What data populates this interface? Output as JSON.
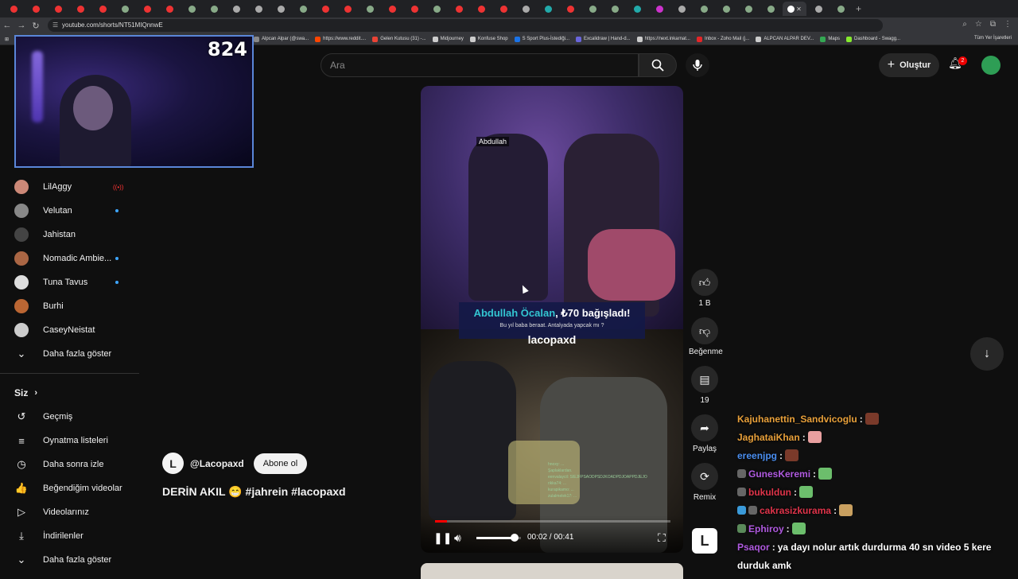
{
  "browser": {
    "url": "youtube.com/shorts/NT51MIQnnwE",
    "tab_colors": [
      "#e33",
      "#e33",
      "#e33",
      "#e33",
      "#e33",
      "#8a8",
      "#e33",
      "#e33",
      "#8a8",
      "#8a8",
      "#aaa",
      "#aaa",
      "#aaa",
      "#8a8",
      "#e33",
      "#e33",
      "#8a8",
      "#e33",
      "#e33",
      "#8a8",
      "#e33",
      "#e33",
      "#e33",
      "#aaa",
      "#2aa",
      "#e33",
      "#8a8",
      "#8a8",
      "#2aa",
      "#c3c",
      "#aaa",
      "#8a8",
      "#8a8",
      "#8a8",
      "#8a8",
      "#fff",
      "#aaa",
      "#8a8"
    ],
    "bookmarks": [
      {
        "label": "Alpcan Alpar (@swa...",
        "color": "#888"
      },
      {
        "label": "https://www.reddit....",
        "color": "#ff4500"
      },
      {
        "label": "Gelen Kutusu (31) -...",
        "color": "#ea4335"
      },
      {
        "label": "Midjourney",
        "color": "#ccc"
      },
      {
        "label": "Konfuse Shop",
        "color": "#ccc"
      },
      {
        "label": "S Sport Plus-İstediği...",
        "color": "#1a73e8"
      },
      {
        "label": "Excalidraw | Hand-d...",
        "color": "#6965db"
      },
      {
        "label": "https://next.inkarnat...",
        "color": "#ccc"
      },
      {
        "label": "Inbox - Zoho Mail (j...",
        "color": "#e42527"
      },
      {
        "label": "ALPCAN ALPAR DEV...",
        "color": "#ccc"
      },
      {
        "label": "Maps",
        "color": "#34a853"
      },
      {
        "label": "Dashboard - Swagg...",
        "color": "#85ea2d"
      }
    ],
    "bookmarks_other": "Tüm Yer İşaretleri"
  },
  "webcam": {
    "count": "824"
  },
  "header": {
    "search_placeholder": "Ara",
    "create_label": "Oluştur",
    "notif_count": "2"
  },
  "sidebar": {
    "subscriptions": [
      {
        "name": "LilAggy",
        "color": "#c87",
        "status": "live"
      },
      {
        "name": "Velutan",
        "color": "#888",
        "status": "dot"
      },
      {
        "name": "Jahistan",
        "color": "#444",
        "status": ""
      },
      {
        "name": "Nomadic Ambie...",
        "color": "#a64",
        "status": "dot"
      },
      {
        "name": "Tuna Tavus",
        "color": "#ddd",
        "status": "dot"
      },
      {
        "name": "Burhi",
        "color": "#b63",
        "status": ""
      },
      {
        "name": "CaseyNeistat",
        "color": "#ccc",
        "status": ""
      }
    ],
    "show_more": "Daha fazla göster",
    "you_heading": "Siz",
    "you_items": [
      {
        "label": "Geçmiş",
        "icon": "history-icon",
        "glyph": "↺"
      },
      {
        "label": "Oynatma listeleri",
        "icon": "playlist-icon",
        "glyph": "≡"
      },
      {
        "label": "Daha sonra izle",
        "icon": "clock-icon",
        "glyph": "◷"
      },
      {
        "label": "Beğendiğim videolar",
        "icon": "thumbs-up-icon",
        "glyph": "👍"
      },
      {
        "label": "Videolarınız",
        "icon": "video-icon",
        "glyph": "▷"
      },
      {
        "label": "İndirilenler",
        "icon": "download-icon",
        "glyph": "⤓"
      }
    ],
    "show_more_2": "Daha fazla göster"
  },
  "video": {
    "name_tag": "Abdullah",
    "caption_name": "Abdullah Öcalan",
    "caption_rest": ", ₺70 bağışladı!",
    "caption_sub": "Bu yıl baba beraat. Antalyada yapcak mı ?",
    "brand": "lacopaxd",
    "chat_overlay": [
      "hnoxy: ...",
      "Şaplaklardan.",
      "eenvalaycil: SIEJFPSAODPSDJKOADPDJOAPPDJEJO",
      "rikka74: ...",
      "kurapikamo: ...",
      "zulalmelek17: ..."
    ],
    "time_current": "00:02",
    "time_total": "00:41",
    "progress": 0.05,
    "volume": 0.85
  },
  "actions": {
    "like_count": "1 B",
    "dislike_label": "Beğenme",
    "comment_count": "19",
    "share_label": "Paylaş",
    "remix_label": "Remix"
  },
  "meta": {
    "channel": "@Lacopaxd",
    "subscribe": "Abone ol",
    "title": "DERİN AKIL 😁 #jahrein #lacopaxd"
  },
  "chat": [
    {
      "user": "Kajuhanettin_Sandvicoglu",
      "color": "#e8a03a",
      "msg": "",
      "emote": "#7a3a2a",
      "badges": []
    },
    {
      "user": "JaghataiKhan",
      "color": "#e8a03a",
      "msg": "",
      "emote": "#e9a0a0",
      "badges": []
    },
    {
      "user": "ereenjpg",
      "color": "#4a8ef0",
      "msg": "",
      "emote": "#7a3a2a",
      "badges": []
    },
    {
      "user": "GunesKeremi",
      "color": "#b05ae0",
      "msg": "",
      "emote": "#6cbe6c",
      "badges": [
        "#666"
      ]
    },
    {
      "user": "bukuldun",
      "color": "#e0344a",
      "msg": "",
      "emote": "#6cbe6c",
      "badges": [
        "#666"
      ]
    },
    {
      "user": "cakrasizkurama",
      "color": "#e0344a",
      "msg": "",
      "emote": "#c9a060",
      "badges": [
        "#3a9ad9",
        "#666"
      ]
    },
    {
      "user": "Ephiroy",
      "color": "#b05ae0",
      "msg": "",
      "emote": "#6cbe6c",
      "badges": [
        "#5a8a5a"
      ]
    },
    {
      "user": "Psaqor",
      "color": "#b05ae0",
      "msg": "ya dayı nolur artık durdurma 40 sn video 5 kere",
      "emote": "",
      "badges": []
    },
    {
      "user": "",
      "color": "#fff",
      "msg": "durduk amk",
      "emote": "",
      "badges": []
    }
  ]
}
